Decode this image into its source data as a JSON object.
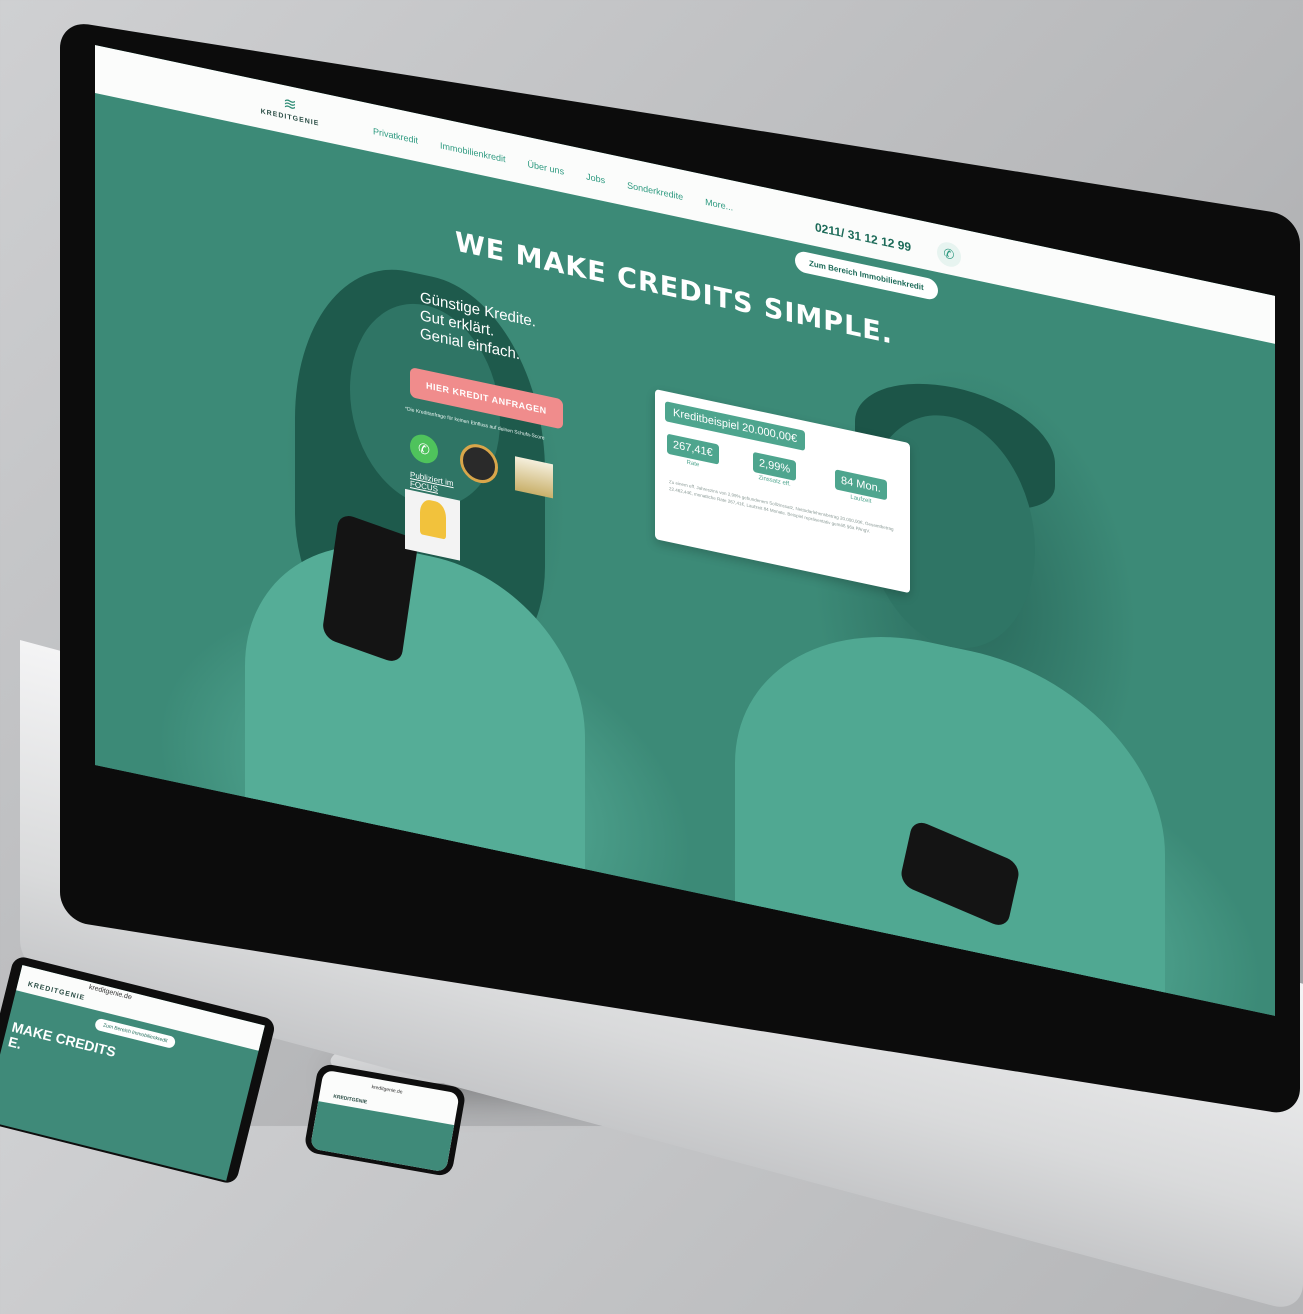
{
  "site": {
    "logo_text": "KREDITGENIE",
    "logo_mark": "≋"
  },
  "nav": {
    "items": [
      "Privatkredit",
      "Immobilienkredit",
      "Über uns",
      "Jobs",
      "Sonderkredite",
      "More..."
    ]
  },
  "contact": {
    "phone": "0211/ 31 12 12 99",
    "phone_icon": "phone-icon"
  },
  "hero": {
    "immo_button": "Zum Bereich Immobilienkredit",
    "headline": "WE MAKE CREDITS SIMPLE.",
    "tagline_1": "Günstige Kredite.",
    "tagline_2": "Gut erklärt.",
    "tagline_3": "Genial einfach.",
    "cta": "HIER KREDIT ANFRAGEN",
    "cta_note": "*Die Kreditanfrage für keinen Einfluss auf deinen Schufa-Score",
    "press_label": "Publiziert im FOCUS"
  },
  "example_card": {
    "title": "Kreditbeispiel 20.000,00€",
    "stats": [
      {
        "value": "267,41€",
        "label": "Rate"
      },
      {
        "value": "2,99%",
        "label": "Zinssatz eff."
      },
      {
        "value": "84 Mon.",
        "label": "Laufzeit"
      }
    ],
    "fine_print": "Zu einem eff. Jahreszins von 2,99% gebundenem Sollzinssatz, Nettodarlehensbetrag 20.000,00€, Gesamtbetrag 22.462,44€, monatliche Rate 267,41€, Laufzeit 84 Monate. Beispiel repräsentativ gemäß §6a PAngV."
  },
  "tablet": {
    "url": "kreditgenie.de",
    "logo_text": "KREDITGENIE",
    "button": "Zum Bereich Immobilienkredit",
    "headline_1": "MAKE CREDITS",
    "headline_2": "E."
  },
  "mobile": {
    "url": "kreditgenie.de",
    "logo_text": "KREDITGENIE"
  },
  "colors": {
    "brand_green": "#3f8a79",
    "accent_green": "#4ea58e",
    "cta_pink": "#f08c8c"
  }
}
